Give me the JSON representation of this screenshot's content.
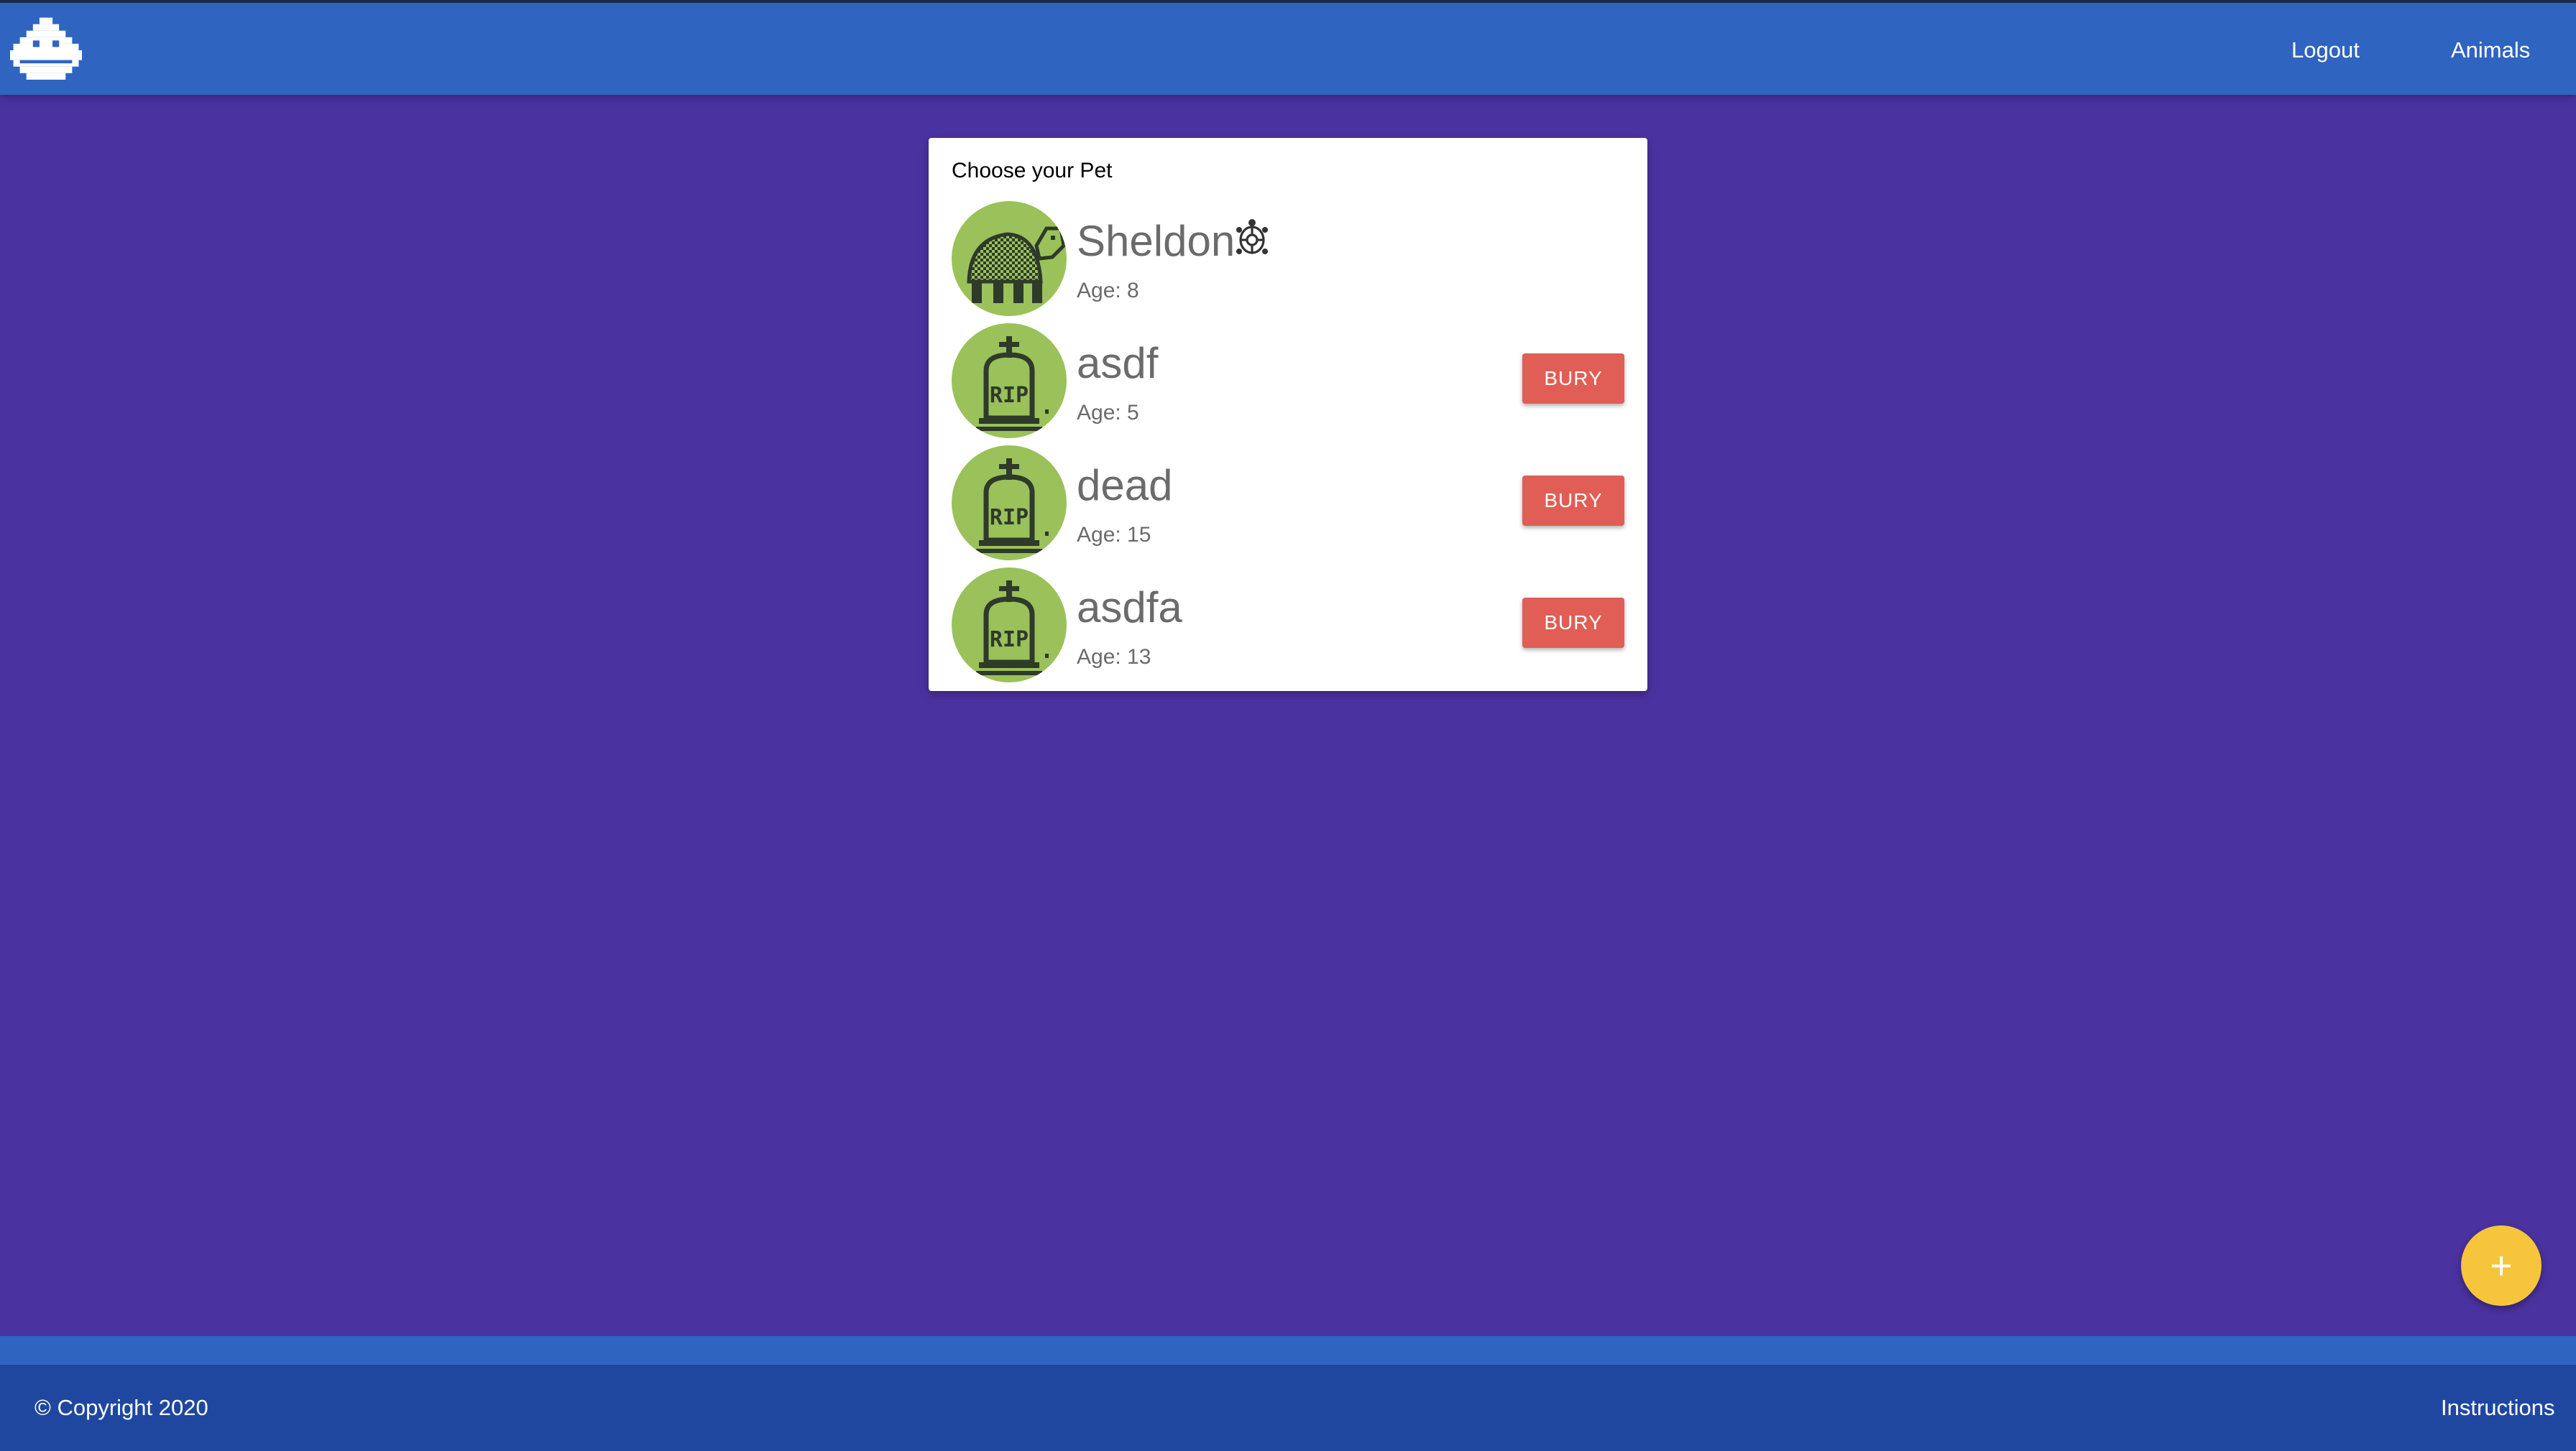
{
  "header": {
    "logo_icon": "space-invader-logo-icon",
    "nav": [
      {
        "label": "Logout"
      },
      {
        "label": "Animals"
      }
    ]
  },
  "card": {
    "title": "Choose your Pet",
    "pets": [
      {
        "name": "Sheldon",
        "age_text": "Age: 8",
        "avatar_icon": "turtle-pixel-icon",
        "status_icon": "turtle-emoji-icon"
      },
      {
        "name": "asdf",
        "age_text": "Age: 5",
        "avatar_icon": "tombstone-rip-icon",
        "action_label": "BURY"
      },
      {
        "name": "dead",
        "age_text": "Age: 15",
        "avatar_icon": "tombstone-rip-icon",
        "action_label": "BURY"
      },
      {
        "name": "asdfa",
        "age_text": "Age: 13",
        "avatar_icon": "tombstone-rip-icon",
        "action_label": "BURY"
      }
    ]
  },
  "fab": {
    "label": "+",
    "icon": "plus-icon"
  },
  "footer": {
    "copyright": "© Copyright 2020",
    "instructions": "Instructions"
  },
  "colors": {
    "background": "#4b32a1",
    "topbar": "#2f64c0",
    "footer": "#1f47a0",
    "avatar": "#9ac15a",
    "bury_button": "#e05e55",
    "fab": "#f7c53b"
  }
}
